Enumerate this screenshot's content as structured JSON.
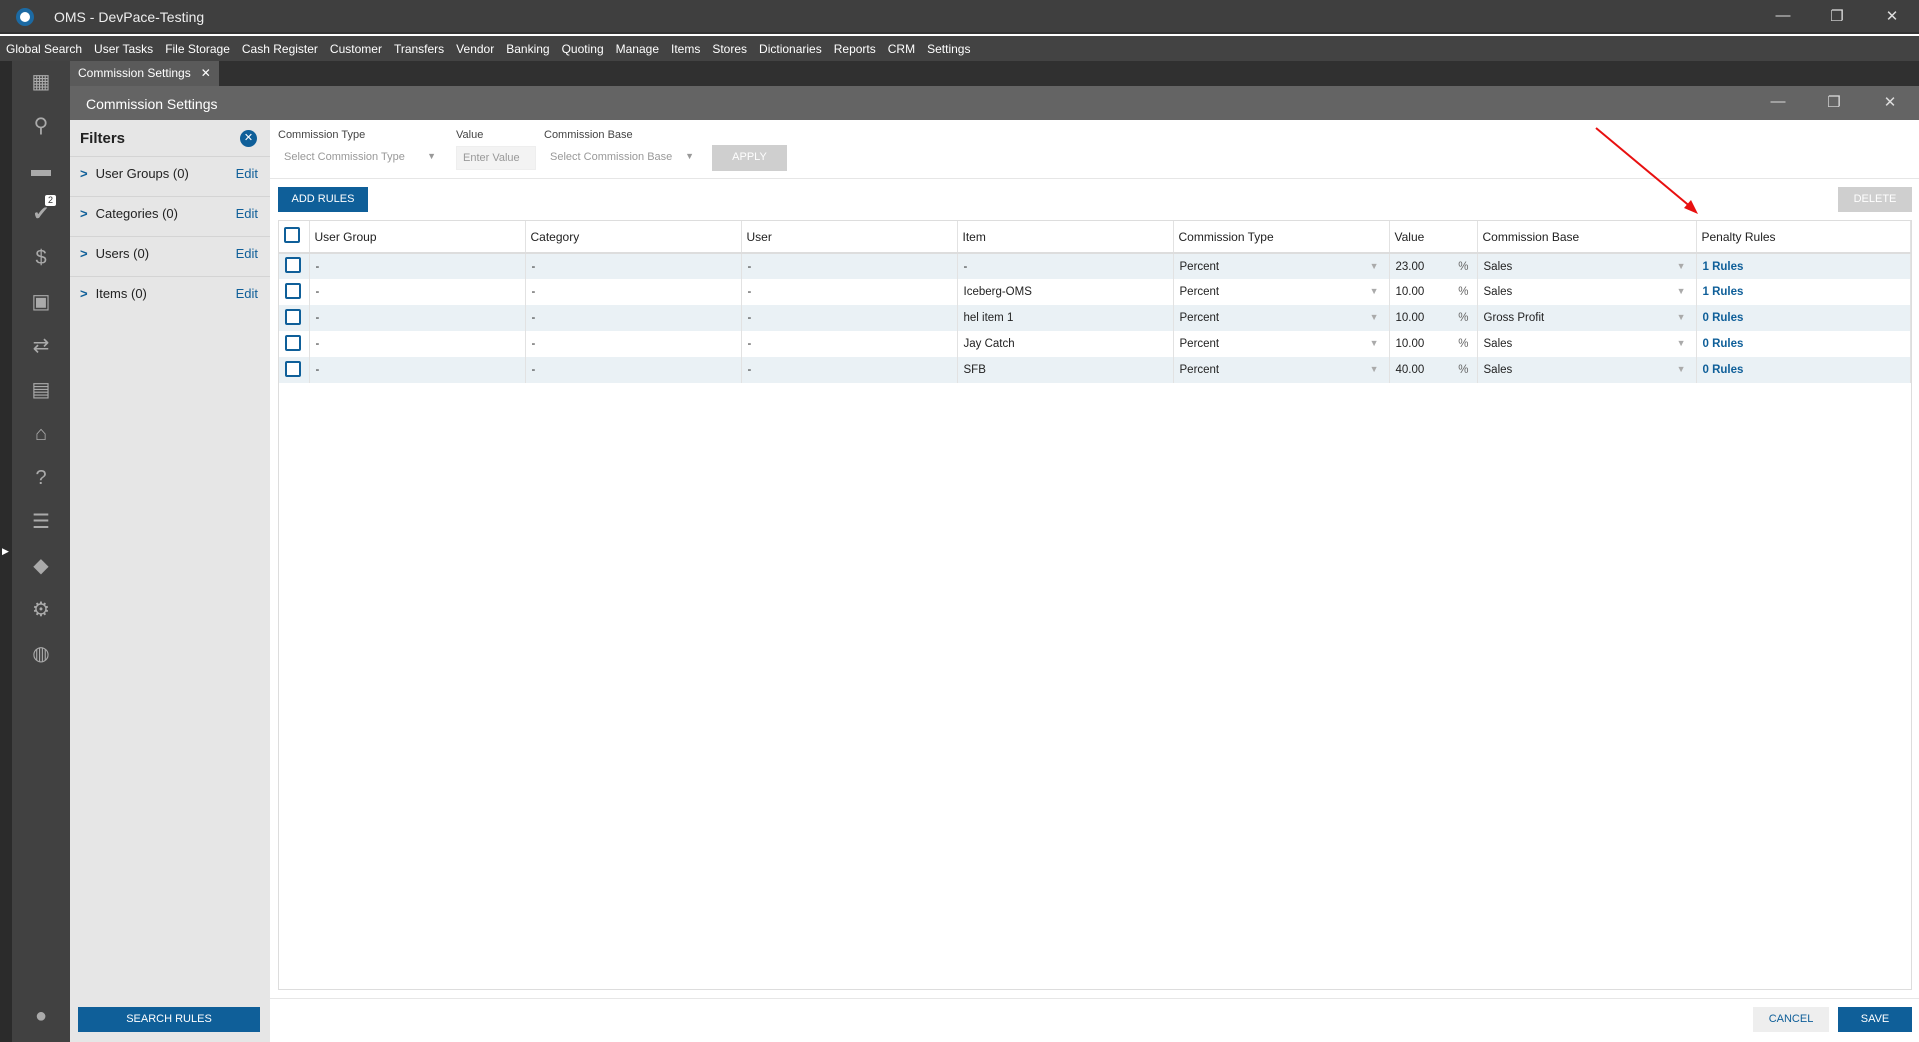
{
  "app": {
    "title": "OMS - DevPace-Testing"
  },
  "menu": [
    "Global Search",
    "User Tasks",
    "File Storage",
    "Cash Register",
    "Customer",
    "Transfers",
    "Vendor",
    "Banking",
    "Quoting",
    "Manage",
    "Items",
    "Stores",
    "Dictionaries",
    "Reports",
    "CRM",
    "Settings"
  ],
  "tab": {
    "label": "Commission Settings"
  },
  "window": {
    "title": "Commission Settings"
  },
  "sidebar": {
    "badge": "2"
  },
  "filters": {
    "title": "Filters",
    "items": [
      {
        "label": "User Groups (0)",
        "edit": "Edit"
      },
      {
        "label": "Categories (0)",
        "edit": "Edit"
      },
      {
        "label": "Users (0)",
        "edit": "Edit"
      },
      {
        "label": "Items (0)",
        "edit": "Edit"
      }
    ],
    "search_button": "SEARCH RULES"
  },
  "toolbar": {
    "commission_type_label": "Commission Type",
    "commission_type_placeholder": "Select Commission Type",
    "value_label": "Value",
    "value_placeholder": "Enter Value",
    "commission_base_label": "Commission Base",
    "commission_base_placeholder": "Select Commission Base",
    "apply": "APPLY",
    "add_rules": "ADD RULES",
    "delete": "DELETE"
  },
  "table": {
    "headers": [
      "User Group",
      "Category",
      "User",
      "Item",
      "Commission Type",
      "Value",
      "Commission Base",
      "Penalty Rules"
    ],
    "rows": [
      [
        "-",
        "-",
        "-",
        "-",
        "Percent",
        "23.00",
        "Sales",
        "1 Rules"
      ],
      [
        "-",
        "-",
        "-",
        "Iceberg-OMS",
        "Percent",
        "10.00",
        "Sales",
        "1 Rules"
      ],
      [
        "-",
        "-",
        "-",
        "hel item 1",
        "Percent",
        "10.00",
        "Gross Profit",
        "0 Rules"
      ],
      [
        "-",
        "-",
        "-",
        "Jay Catch",
        "Percent",
        "10.00",
        "Sales",
        "0 Rules"
      ],
      [
        "-",
        "-",
        "-",
        "SFB",
        "Percent",
        "40.00",
        "Sales",
        "0 Rules"
      ]
    ],
    "percent_symbol": "%"
  },
  "footer": {
    "cancel": "CANCEL",
    "save": "SAVE"
  }
}
